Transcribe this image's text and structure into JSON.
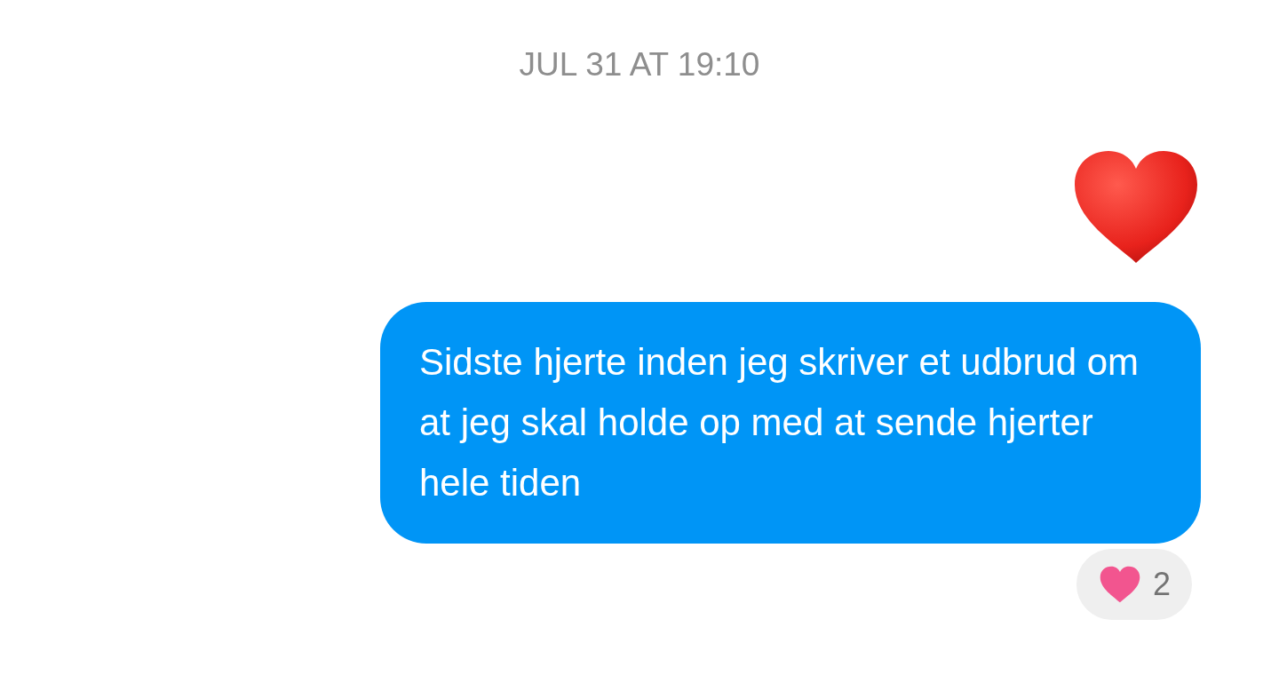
{
  "timestamp": "JUL 31 AT 19:10",
  "messages": [
    {
      "kind": "emoji"
    },
    {
      "kind": "text",
      "text": "Sidste hjerte inden jeg skriver et udbrud om at jeg skal holde op med at sende hjerter hele tiden",
      "reaction": {
        "count": "2"
      }
    }
  ]
}
